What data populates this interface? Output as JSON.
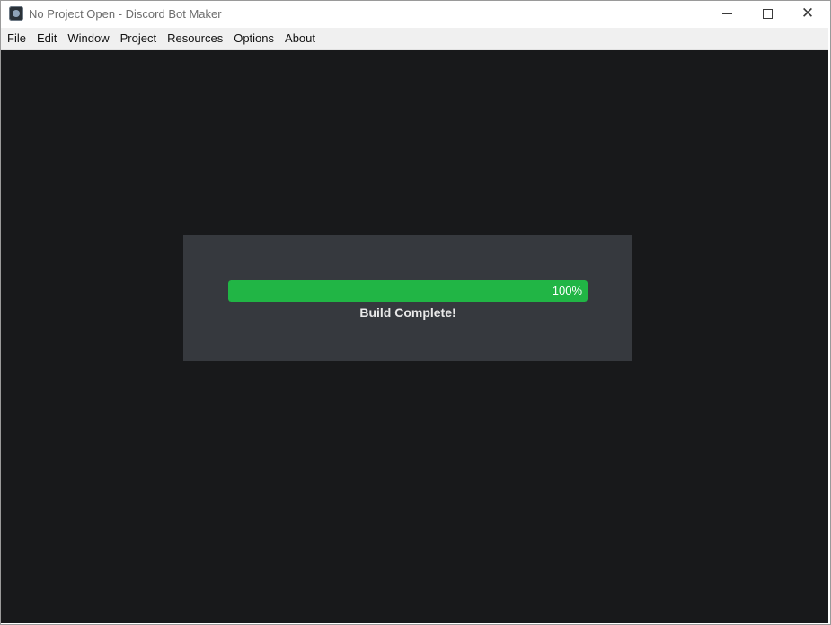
{
  "window": {
    "title": "No Project Open - Discord Bot Maker",
    "icon": "discord-bot-maker-app-icon"
  },
  "menu": {
    "items": [
      "File",
      "Edit",
      "Window",
      "Project",
      "Resources",
      "Options",
      "About"
    ]
  },
  "build_dialog": {
    "progress_percent": 100,
    "progress_label": "100%",
    "status": "Build Complete!",
    "fill_color": "#21b545",
    "dialog_color": "#36393e",
    "background_color": "#18191b"
  }
}
